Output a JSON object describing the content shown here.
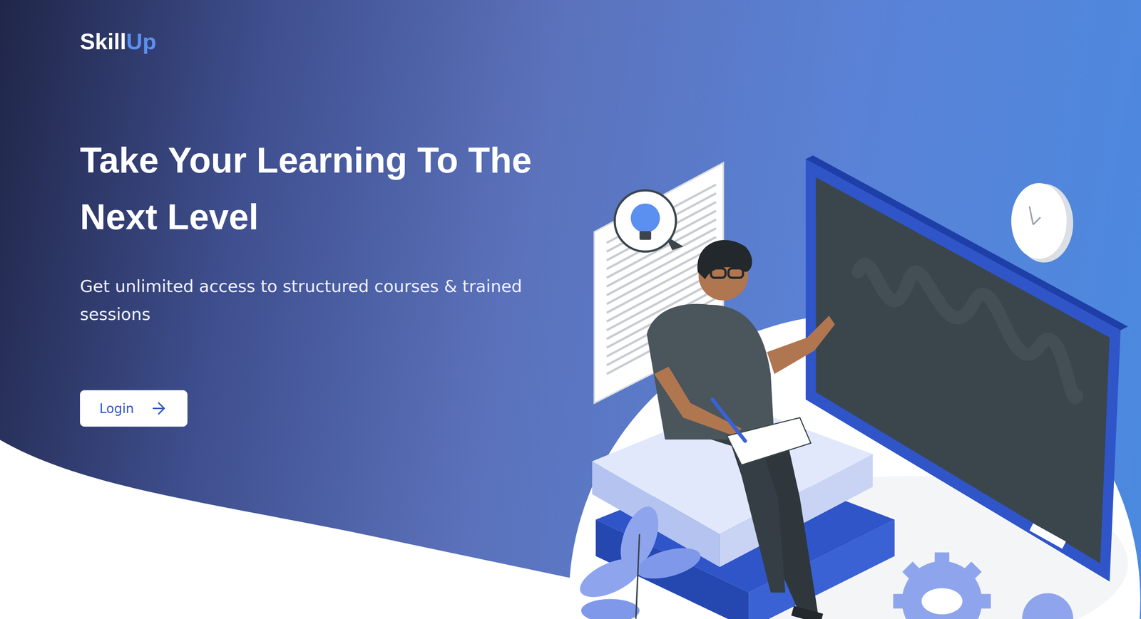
{
  "logo": {
    "primary": "Skill",
    "accent": "Up"
  },
  "hero": {
    "title": "Take Your Learning To The Next Level",
    "subtitle": "Get unlimited access to structured courses & trained sessions",
    "button": {
      "label": "Login"
    }
  }
}
